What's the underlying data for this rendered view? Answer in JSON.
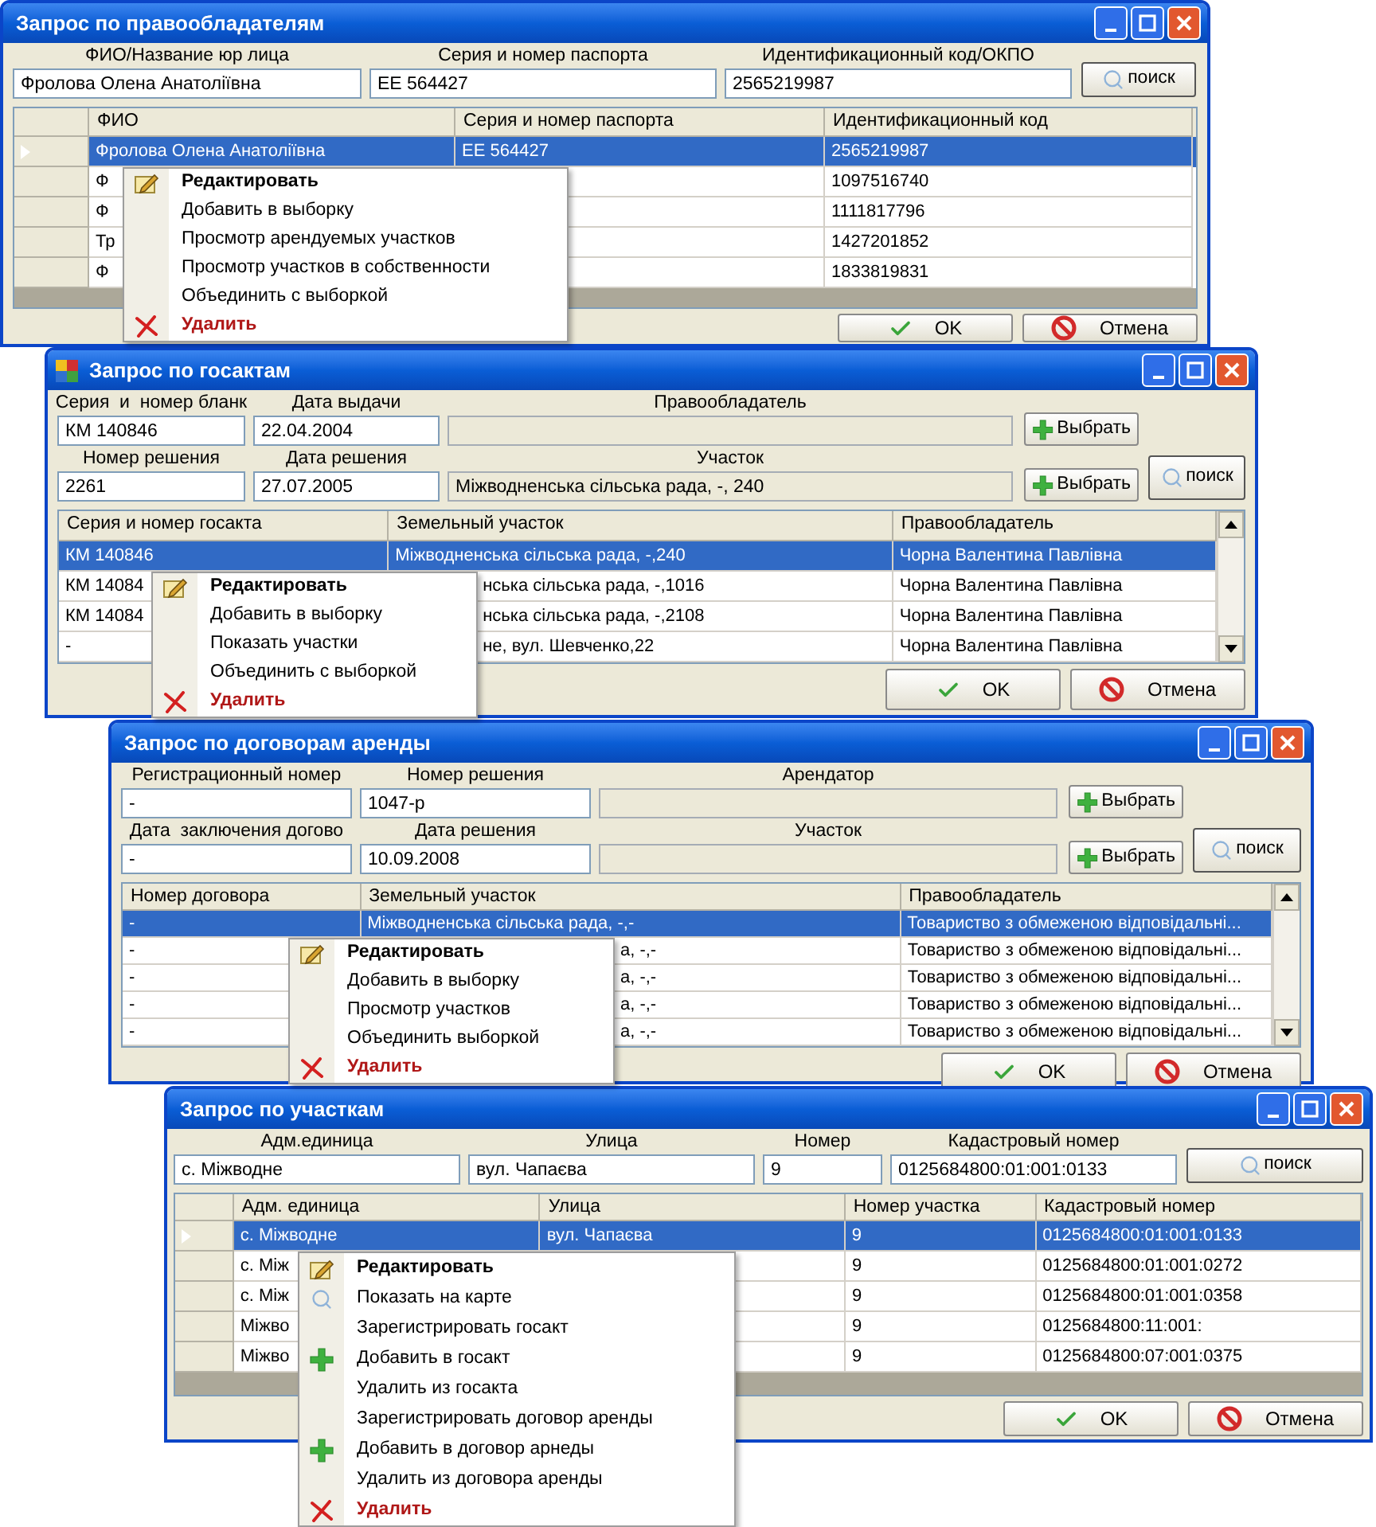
{
  "windows": [
    {
      "title": "Запрос по правообладателям",
      "form_rows": [
        {
          "fields": [
            {
              "label": "ФИО/Название юр лица",
              "value": "Фролова Олена Анатоліївна",
              "readonly": false
            },
            {
              "label": "Серия и номер паспорта",
              "value": "ЕЕ 564427",
              "readonly": false
            },
            {
              "label": "Идентификационный код/ОКПО",
              "value": "2565219987",
              "readonly": false
            }
          ]
        }
      ],
      "search_button": "поиск",
      "table": {
        "row_headers": true,
        "columns": [
          "ФИО",
          "Серия и номер паспорта",
          "Идентификационный код"
        ],
        "rows": [
          {
            "selected": true,
            "cells": [
              "Фролова Олена Анатоліївна",
              "ЕЕ 564427",
              "2565219987"
            ]
          },
          {
            "selected": false,
            "cells": [
              "Ф",
              null,
              "1097516740"
            ]
          },
          {
            "selected": false,
            "cells": [
              "Ф",
              null,
              "1111817796"
            ]
          },
          {
            "selected": false,
            "cells": [
              "Тр",
              null,
              "1427201852"
            ]
          },
          {
            "selected": false,
            "cells": [
              "Ф",
              null,
              "1833819831"
            ]
          }
        ]
      },
      "context_menu": [
        {
          "label": "Редактировать",
          "kind": "edit"
        },
        {
          "label": "Добавить в выборку",
          "kind": "plain"
        },
        {
          "label": "Просмотр арендуемых участков",
          "kind": "plain"
        },
        {
          "label": "Просмотр участков в собственности",
          "kind": "plain"
        },
        {
          "label": "Объединить с выборкой",
          "kind": "plain"
        },
        {
          "label": "Удалить",
          "kind": "delete"
        }
      ],
      "buttons": [
        {
          "label": "OK",
          "kind": "ok"
        },
        {
          "label": "Отмена",
          "kind": "cancel"
        }
      ]
    },
    {
      "title": "Запрос по госактам",
      "form_rows": [
        {
          "fields": [
            {
              "label": "Серия  и  номер бланк",
              "value": "КМ 140846",
              "readonly": false
            },
            {
              "label": "Дата выдачи",
              "value": "22.04.2004",
              "readonly": false
            },
            {
              "label": "Правообладатель",
              "readonly": true
            }
          ],
          "button": "Выбрать"
        },
        {
          "fields": [
            {
              "label": "Номер решения",
              "value": "2261",
              "readonly": false
            },
            {
              "label": "Дата решения",
              "value": "27.07.2005",
              "readonly": false
            },
            {
              "label": "Участок",
              "value": "Міжводненська сільська рада, -, 240",
              "readonly": true
            }
          ],
          "button": "Выбрать"
        }
      ],
      "search_button": "поиск",
      "table": {
        "row_headers": false,
        "columns": [
          "Серия и номер госакта",
          "Земельный участок",
          "Правообладатель"
        ],
        "rows": [
          {
            "selected": true,
            "cells": [
              "КМ 140846",
              "Міжводненська сільська рада, -,240",
              "Чорна Валентина Павлівна"
            ]
          },
          {
            "selected": false,
            "cells": [
              "КМ 14084",
              "нська сільська рада, -,1016",
              "Чорна Валентина Павлівна"
            ]
          },
          {
            "selected": false,
            "cells": [
              "КМ 14084",
              "нська сільська рада, -,2108",
              "Чорна Валентина Павлівна"
            ]
          },
          {
            "selected": false,
            "cells": [
              "-",
              "не, вул. Шевченко,22",
              "Чорна Валентина Павлівна"
            ]
          }
        ]
      },
      "context_menu": [
        {
          "label": "Редактировать",
          "kind": "edit"
        },
        {
          "label": "Добавить в выборку",
          "kind": "plain"
        },
        {
          "label": "Показать участки",
          "kind": "plain"
        },
        {
          "label": "Объединить с выборкой",
          "kind": "plain"
        },
        {
          "label": "Удалить",
          "kind": "delete"
        }
      ],
      "buttons": [
        {
          "label": "OK",
          "kind": "ok"
        },
        {
          "label": "Отмена",
          "kind": "cancel"
        }
      ]
    },
    {
      "title": "Запрос по договорам аренды",
      "form_rows": [
        {
          "fields": [
            {
              "label": "Регистрационный номер",
              "value": "-",
              "readonly": false
            },
            {
              "label": "Номер решения",
              "value": "1047-р",
              "readonly": false
            },
            {
              "label": "Арендатор",
              "readonly": true
            }
          ],
          "button": "Выбрать"
        },
        {
          "fields": [
            {
              "label": "Дата  заключения догово",
              "value": "-",
              "readonly": false
            },
            {
              "label": "Дата решения",
              "value": "10.09.2008",
              "readonly": false
            },
            {
              "label": "Участок",
              "readonly": true
            }
          ],
          "button": "Выбрать"
        }
      ],
      "search_button": "поиск",
      "table": {
        "row_headers": false,
        "columns": [
          "Номер договора",
          "Земельный участок",
          "Правообладатель"
        ],
        "rows": [
          {
            "selected": true,
            "cells": [
              "-",
              "Міжводненська сільська рада, -,-",
              "Товариство з обмеженою відповідальні..."
            ]
          },
          {
            "selected": false,
            "cells": [
              "-",
              "а, -,-",
              "Товариство з обмеженою відповідальні..."
            ]
          },
          {
            "selected": false,
            "cells": [
              "-",
              "а, -,-",
              "Товариство з обмеженою відповідальні..."
            ]
          },
          {
            "selected": false,
            "cells": [
              "-",
              "а, -,-",
              "Товариство з обмеженою відповідальні..."
            ]
          },
          {
            "selected": false,
            "cells": [
              "-",
              "а, -,-",
              "Товариство з обмеженою відповідальні..."
            ]
          }
        ]
      },
      "context_menu": [
        {
          "label": "Редактировать",
          "kind": "edit"
        },
        {
          "label": "Добавить в выборку",
          "kind": "plain"
        },
        {
          "label": "Просмотр участков",
          "kind": "plain"
        },
        {
          "label": "Объединить выборкой",
          "kind": "plain"
        },
        {
          "label": "Удалить",
          "kind": "delete"
        }
      ],
      "buttons": [
        {
          "label": "OK",
          "kind": "ok"
        },
        {
          "label": "Отмена",
          "kind": "cancel"
        }
      ]
    },
    {
      "title": "Запрос по участкам",
      "form_rows": [
        {
          "fields": [
            {
              "label": "Адм.единица",
              "value": "с. Міжводне",
              "readonly": false
            },
            {
              "label": "Улица",
              "value": "вул. Чапаєва",
              "readonly": false
            },
            {
              "label": "Номер",
              "value": "9",
              "readonly": false
            },
            {
              "label": "Кадастровый номер",
              "value": "0125684800:01:001:0133",
              "readonly": false
            }
          ]
        }
      ],
      "search_button": "поиск",
      "table": {
        "row_headers": true,
        "columns": [
          "Адм. единица",
          "Улица",
          "Номер участка",
          "Кадастровый номер"
        ],
        "rows": [
          {
            "selected": true,
            "cells": [
              "с. Міжводне",
              "вул. Чапаєва",
              "9",
              "0125684800:01:001:0133"
            ]
          },
          {
            "selected": false,
            "cells": [
              "с. Між",
              null,
              "9",
              "0125684800:01:001:0272"
            ]
          },
          {
            "selected": false,
            "cells": [
              "с. Між",
              null,
              "9",
              "0125684800:01:001:0358"
            ]
          },
          {
            "selected": false,
            "cells": [
              "Міжво",
              null,
              "9",
              "0125684800:11:001:"
            ]
          },
          {
            "selected": false,
            "cells": [
              "Міжво",
              null,
              "9",
              "0125684800:07:001:0375"
            ]
          }
        ]
      },
      "context_menu": [
        {
          "label": "Редактировать",
          "kind": "edit"
        },
        {
          "label": "Показать на карте",
          "kind": "find"
        },
        {
          "label": "Зарегистрировать госакт",
          "kind": "plain"
        },
        {
          "label": "Добавить в госакт",
          "kind": "add"
        },
        {
          "label": "Удалить из госакта",
          "kind": "plain"
        },
        {
          "label": "Зарегистрировать договор аренды",
          "kind": "plain"
        },
        {
          "label": "Добавить в договор арнеды",
          "kind": "add"
        },
        {
          "label": "Удалить из договора аренды",
          "kind": "plain"
        },
        {
          "label": "Удалить",
          "kind": "delete"
        }
      ],
      "buttons": [
        {
          "label": "OK",
          "kind": "ok"
        },
        {
          "label": "Отмена",
          "kind": "cancel"
        }
      ]
    }
  ]
}
